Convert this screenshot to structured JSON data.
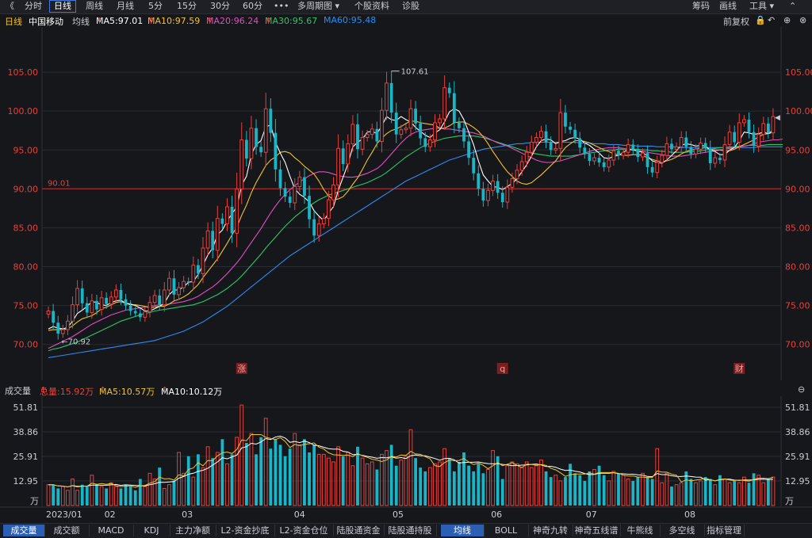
{
  "toolbar": {
    "back": "《",
    "periods": [
      "分时",
      "日线",
      "周线",
      "月线",
      "5分",
      "15分",
      "30分",
      "60分"
    ],
    "active_period": "日线",
    "more": "•••",
    "multi_period": "多周期图",
    "stock_info": "个股资料",
    "diagnose": "诊股",
    "chips": "筹码",
    "draw": "画线",
    "tools": "工具"
  },
  "info": {
    "period": "日线",
    "name": "中国移动",
    "avg_label": "均线",
    "ma5": "MA5:97.01",
    "ma10": "MA10:97.59",
    "ma20": "MA20:96.24",
    "ma30": "MA30:95.67",
    "ma60": "MA60:95.48",
    "adjust": "前复权"
  },
  "colors": {
    "up": "#e8403c",
    "down": "#1ab6c7",
    "ma5": "#ffffff",
    "ma10": "#f2c230",
    "ma20": "#e04fbf",
    "ma30": "#2cc56a",
    "ma60": "#2e8bf0",
    "grid": "#2a2c33",
    "axis_text": "#e8403c"
  },
  "chart_data": [
    {
      "type": "candlestick",
      "ylim": [
        66,
        110
      ],
      "yticks": [
        "105.00",
        "100.00",
        "95.00",
        "90.00",
        "85.00",
        "80.00",
        "75.00",
        "70.00"
      ],
      "hline": {
        "value": 90.01,
        "label": "90.01"
      },
      "annotations": [
        {
          "label": "107.61",
          "type": "high"
        },
        {
          "label": "70.92",
          "type": "low"
        }
      ],
      "markers": [
        "涨",
        "q",
        "财"
      ],
      "closes": [
        74.3,
        72.8,
        71.4,
        71.9,
        73.0,
        75.1,
        77.2,
        75.3,
        74.1,
        75.6,
        74.5,
        76.0,
        75.2,
        76.1,
        77.0,
        75.8,
        75.0,
        74.3,
        74.0,
        73.5,
        74.2,
        75.4,
        76.3,
        75.1,
        77.0,
        78.5,
        76.4,
        77.3,
        78.1,
        78.0,
        80.2,
        79.1,
        82.4,
        84.6,
        82.1,
        86.2,
        85.5,
        87.7,
        84.3,
        90.0,
        96.3,
        93.9,
        97.8,
        95.4,
        94.7,
        100.3,
        97.2,
        92.5,
        90.1,
        89.0,
        88.2,
        90.3,
        91.5,
        89.1,
        86.1,
        84.0,
        85.5,
        86.2,
        88.6,
        90.5,
        95.2,
        93.2,
        95.8,
        98.3,
        95.1,
        96.6,
        97.0,
        97.7,
        96.1,
        100.1,
        103.6,
        99.8,
        97.0,
        97.6,
        97.8,
        100.3,
        98.4,
        96.5,
        95.4,
        96.3,
        98.5,
        99.0,
        103.0,
        102.3,
        98.5,
        97.8,
        96.1,
        94.0,
        92.0,
        90.0,
        88.5,
        89.8,
        91.0,
        89.5,
        88.3,
        90.2,
        91.3,
        92.4,
        93.5,
        94.7,
        96.0,
        96.6,
        97.4,
        96.0,
        95.0,
        95.2,
        99.8,
        98.0,
        97.6,
        96.5,
        95.3,
        94.5,
        93.6,
        94.0,
        93.4,
        92.8,
        93.7,
        94.9,
        94.3,
        94.7,
        95.7,
        95.0,
        94.1,
        94.6,
        92.8,
        92.1,
        93.4,
        94.3,
        95.8,
        95.1,
        95.4,
        96.6,
        95.4,
        94.5,
        95.1,
        95.9,
        95.2,
        93.3,
        94.0,
        93.7,
        95.7,
        97.3,
        96.0,
        98.5,
        98.9,
        97.3,
        95.5,
        97.0,
        98.4,
        97.2,
        99.3
      ],
      "ma5": [
        72.0,
        72.3,
        72.1,
        72.0,
        72.2,
        73.0,
        74.0,
        74.4,
        74.9,
        75.5,
        75.4,
        75.1,
        75.0,
        75.4,
        75.6,
        75.7,
        75.3,
        75.2,
        75.0,
        74.7,
        74.3,
        74.3,
        74.6,
        74.9,
        75.3,
        76.4,
        77.0,
        77.0,
        77.4,
        78.0,
        78.1,
        79.0,
        80.2,
        81.5,
        82.4,
        84.1,
        84.7,
        85.9,
        86.8,
        87.7,
        90.5,
        91.6,
        94.4,
        95.7,
        96.2,
        98.0,
        98.2,
        96.0,
        94.6,
        93.4,
        91.6,
        90.0,
        89.3,
        88.9,
        88.3,
        87.2,
        86.5,
        85.9,
        86.9,
        87.7,
        89.8,
        91.5,
        93.2,
        95.4,
        96.0,
        96.4,
        97.3,
        97.4,
        97.1,
        98.1,
        99.3,
        98.9,
        98.8,
        99.3,
        98.9,
        98.6,
        97.9,
        97.4,
        96.9,
        96.6,
        97.2,
        97.6,
        98.6,
        99.9,
        100.3,
        100.0,
        98.9,
        97.3,
        95.7,
        93.6,
        91.8,
        91.0,
        90.3,
        90.2,
        89.9,
        90.3,
        90.7,
        91.3,
        92.2,
        93.1,
        94.2,
        95.4,
        96.2,
        96.4,
        96.3,
        95.8,
        96.1,
        96.2,
        96.5,
        96.6,
        96.4,
        95.9,
        95.6,
        95.1,
        94.6,
        94.0,
        93.9,
        94.2,
        94.3,
        94.7,
        95.1,
        95.0,
        94.9,
        94.7,
        94.2,
        93.6,
        93.4,
        93.3,
        93.7,
        94.3,
        94.9,
        95.6,
        95.8,
        95.7,
        95.5,
        95.6,
        95.5,
        95.0,
        94.8,
        94.4,
        94.4,
        95.0,
        95.3,
        96.2,
        97.3,
        97.2,
        97.0,
        97.1,
        97.3,
        97.1,
        97.3
      ],
      "ma10": [
        71.8,
        71.9,
        71.9,
        71.9,
        72.0,
        72.4,
        72.9,
        73.3,
        73.5,
        73.7,
        74.1,
        74.6,
        74.8,
        75.1,
        75.4,
        75.5,
        75.3,
        75.1,
        75.1,
        75.0,
        74.9,
        74.7,
        74.8,
        74.9,
        74.9,
        75.2,
        75.6,
        75.8,
        76.1,
        76.5,
        77.1,
        77.7,
        78.6,
        79.4,
        80.2,
        81.0,
        82.0,
        83.0,
        84.1,
        85.1,
        86.6,
        87.9,
        89.5,
        90.8,
        91.9,
        93.0,
        93.7,
        94.1,
        94.7,
        94.8,
        94.6,
        94.0,
        93.5,
        92.9,
        92.4,
        91.9,
        91.0,
        89.9,
        89.1,
        88.6,
        88.7,
        89.0,
        89.7,
        90.6,
        91.4,
        92.5,
        93.7,
        94.7,
        95.8,
        96.5,
        97.1,
        97.5,
        97.7,
        98.0,
        98.4,
        98.7,
        98.7,
        98.5,
        98.4,
        98.3,
        98.2,
        97.8,
        97.8,
        98.1,
        98.5,
        98.6,
        98.6,
        98.3,
        97.9,
        97.4,
        96.7,
        95.8,
        94.8,
        93.9,
        93.0,
        92.2,
        91.6,
        91.0,
        90.7,
        90.6,
        90.8,
        91.3,
        91.8,
        92.4,
        93.0,
        93.6,
        94.5,
        95.3,
        95.8,
        96.2,
        96.2,
        96.1,
        95.9,
        95.6,
        95.3,
        95.0,
        94.8,
        94.5,
        94.4,
        94.3,
        94.3,
        94.4,
        94.4,
        94.3,
        94.0,
        93.8,
        93.6,
        93.5,
        93.6,
        93.8,
        94.1,
        94.5,
        94.8,
        95.0,
        95.1,
        95.2,
        95.3,
        95.1,
        95.0,
        95.0,
        94.9,
        94.9,
        95.1,
        95.4,
        95.7,
        96.0,
        96.3,
        96.7,
        97.0,
        97.1,
        97.6
      ],
      "ma20": [
        69.5,
        69.8,
        70.1,
        70.4,
        70.7,
        71.0,
        71.4,
        71.8,
        72.2,
        72.6,
        72.9,
        73.2,
        73.5,
        73.8,
        74.0,
        74.2,
        74.4,
        74.5,
        74.6,
        74.7,
        74.8,
        74.9,
        75.0,
        75.1,
        75.1,
        75.2,
        75.3,
        75.4,
        75.5,
        75.7,
        75.9,
        76.2,
        76.6,
        77.0,
        77.4,
        77.9,
        78.5,
        79.1,
        79.8,
        80.5,
        81.3,
        82.2,
        83.1,
        84.0,
        84.9,
        85.9,
        86.9,
        87.8,
        88.6,
        89.3,
        89.9,
        90.4,
        90.9,
        91.3,
        91.7,
        92.0,
        92.2,
        92.2,
        92.1,
        91.9,
        91.7,
        91.6,
        91.5,
        91.5,
        91.6,
        91.8,
        92.0,
        92.3,
        92.6,
        93.1,
        93.8,
        94.5,
        95.2,
        95.9,
        96.5,
        97.0,
        97.3,
        97.5,
        97.6,
        97.7,
        97.8,
        97.8,
        97.7,
        97.7,
        97.6,
        97.5,
        97.4,
        97.3,
        97.2,
        97.0,
        96.8,
        96.5,
        96.2,
        95.9,
        95.7,
        95.5,
        95.2,
        94.9,
        94.6,
        94.3,
        94.0,
        93.7,
        93.5,
        93.4,
        93.4,
        93.5,
        93.6,
        93.8,
        94.0,
        94.2,
        94.4,
        94.6,
        94.8,
        95.0,
        95.1,
        95.2,
        95.3,
        95.3,
        95.3,
        95.2,
        95.1,
        95.0,
        94.9,
        94.8,
        94.7,
        94.6,
        94.5,
        94.4,
        94.3,
        94.2,
        94.2,
        94.2,
        94.3,
        94.4,
        94.5,
        94.6,
        94.7,
        94.8,
        94.9,
        95.0,
        95.1,
        95.2,
        95.3,
        95.4,
        95.5,
        95.6,
        95.8,
        96.0,
        96.1,
        96.2,
        96.3,
        96.3,
        96.4
      ],
      "ma30": [
        69.2,
        69.4,
        69.5,
        69.7,
        69.9,
        70.1,
        70.3,
        70.6,
        70.9,
        71.2,
        71.5,
        71.8,
        72.1,
        72.4,
        72.7,
        73.0,
        73.2,
        73.4,
        73.6,
        73.8,
        74.0,
        74.1,
        74.3,
        74.4,
        74.5,
        74.6,
        74.7,
        74.8,
        74.9,
        75.0,
        75.1,
        75.3,
        75.5,
        75.8,
        76.1,
        76.4,
        76.8,
        77.2,
        77.7,
        78.2,
        78.8,
        79.5,
        80.2,
        80.9,
        81.6,
        82.4,
        83.1,
        83.8,
        84.5,
        85.2,
        85.8,
        86.4,
        86.9,
        87.4,
        87.8,
        88.2,
        88.6,
        88.9,
        89.2,
        89.4,
        89.6,
        89.8,
        90.0,
        90.2,
        90.4,
        90.6,
        90.8,
        91.1,
        91.4,
        91.7,
        92.1,
        92.6,
        93.1,
        93.6,
        94.1,
        94.5,
        94.9,
        95.3,
        95.6,
        95.9,
        96.1,
        96.3,
        96.5,
        96.6,
        96.7,
        96.8,
        96.8,
        96.8,
        96.8,
        96.7,
        96.6,
        96.4,
        96.2,
        96.0,
        95.8,
        95.6,
        95.4,
        95.2,
        95.0,
        94.8,
        94.6,
        94.5,
        94.4,
        94.3,
        94.2,
        94.2,
        94.2,
        94.2,
        94.2,
        94.3,
        94.4,
        94.5,
        94.6,
        94.7,
        94.8,
        94.9,
        95.0,
        95.0,
        95.1,
        95.1,
        95.1,
        95.1,
        95.1,
        95.0,
        95.0,
        94.9,
        94.9,
        94.8,
        94.8,
        94.7,
        94.7,
        94.7,
        94.7,
        94.8,
        94.8,
        94.9,
        95.0,
        95.1,
        95.2,
        95.3,
        95.3,
        95.4,
        95.4,
        95.5,
        95.5,
        95.6,
        95.6,
        95.6,
        95.6,
        95.7,
        95.7,
        95.7,
        95.7
      ],
      "ma60": [
        68.3,
        68.4,
        68.5,
        68.6,
        68.7,
        68.8,
        68.9,
        69.0,
        69.1,
        69.2,
        69.3,
        69.4,
        69.5,
        69.6,
        69.7,
        69.8,
        69.9,
        70.0,
        70.1,
        70.2,
        70.3,
        70.4,
        70.5,
        70.7,
        70.9,
        71.1,
        71.3,
        71.5,
        71.7,
        72.0,
        72.3,
        72.6,
        72.9,
        73.3,
        73.7,
        74.1,
        74.5,
        74.9,
        75.4,
        75.9,
        76.4,
        76.9,
        77.4,
        77.9,
        78.4,
        78.9,
        79.4,
        79.9,
        80.4,
        80.9,
        81.4,
        81.8,
        82.2,
        82.6,
        83.0,
        83.4,
        83.8,
        84.2,
        84.6,
        85.0,
        85.4,
        85.8,
        86.2,
        86.6,
        87.0,
        87.4,
        87.8,
        88.2,
        88.6,
        89.0,
        89.4,
        89.8,
        90.2,
        90.6,
        91.0,
        91.3,
        91.6,
        91.9,
        92.2,
        92.5,
        92.8,
        93.1,
        93.4,
        93.7,
        93.9,
        94.1,
        94.3,
        94.5,
        94.7,
        94.9,
        95.1,
        95.2,
        95.3,
        95.4,
        95.5,
        95.6,
        95.7,
        95.8,
        95.8,
        95.9,
        95.9,
        96.0,
        96.0,
        96.0,
        96.0,
        96.0,
        96.0,
        96.0,
        96.0,
        96.0,
        95.9,
        95.9,
        95.9,
        95.8,
        95.8,
        95.8,
        95.7,
        95.7,
        95.7,
        95.6,
        95.6,
        95.6,
        95.5,
        95.5,
        95.5,
        95.5,
        95.4,
        95.4,
        95.4,
        95.4,
        95.4,
        95.3,
        95.3,
        95.3,
        95.3,
        95.3,
        95.3,
        95.3,
        95.3,
        95.3,
        95.3,
        95.3,
        95.3,
        95.3,
        95.3,
        95.3,
        95.3,
        95.4,
        95.4,
        95.4,
        95.4,
        95.4,
        95.4
      ]
    },
    {
      "type": "bar",
      "ylim": [
        0,
        56
      ],
      "yticks": [
        "51.81",
        "38.86",
        "25.91",
        "12.95"
      ],
      "unit": "万",
      "xticks": [
        "2023/01",
        "02",
        "03",
        "04",
        "05",
        "06",
        "07",
        "08"
      ],
      "values": [
        11,
        11,
        9,
        10,
        8,
        14,
        8,
        11,
        10,
        16,
        11,
        10,
        9,
        12,
        10,
        9,
        11,
        10,
        8,
        14,
        10,
        17,
        14,
        20,
        9,
        11,
        13,
        28,
        17,
        26,
        15,
        27,
        20,
        31,
        25,
        28,
        35,
        22,
        27,
        36,
        53,
        33,
        38,
        27,
        36,
        46,
        30,
        35,
        32,
        26,
        30,
        38,
        32,
        35,
        28,
        32,
        27,
        27,
        25,
        23,
        31,
        26,
        28,
        21,
        31,
        25,
        22,
        23,
        19,
        27,
        29,
        32,
        21,
        24,
        26,
        40,
        25,
        20,
        18,
        20,
        22,
        23,
        30,
        25,
        18,
        23,
        28,
        21,
        18,
        22,
        17,
        19,
        29,
        26,
        14,
        21,
        23,
        22,
        20,
        23,
        20,
        21,
        24,
        18,
        15,
        16,
        13,
        15,
        22,
        17,
        16,
        13,
        18,
        19,
        21,
        16,
        13,
        18,
        17,
        16,
        14,
        13,
        15,
        17,
        15,
        14,
        30,
        12,
        17,
        10,
        11,
        12,
        18,
        14,
        12,
        13,
        15,
        14,
        11,
        16,
        14,
        12,
        13,
        12,
        15,
        12,
        17,
        16,
        12,
        14,
        15
      ]
    }
  ],
  "subchart": {
    "title": "成交量",
    "total": "总量:15.92万",
    "ma5": "MA5:10.57万",
    "ma10": "MA10:10.12万"
  },
  "bottom_tabs": [
    "成交量",
    "成交额",
    "MACD",
    "KDJ",
    "主力净额",
    "L2-资金抄底",
    "L2-资金仓位",
    "陆股通资金",
    "陆股通持股",
    "均线",
    "BOLL",
    "神奇九转",
    "神奇五线谱",
    "牛熊线",
    "多空线",
    "指标管理"
  ],
  "active_bottom_tabs": [
    "成交量",
    "均线"
  ]
}
